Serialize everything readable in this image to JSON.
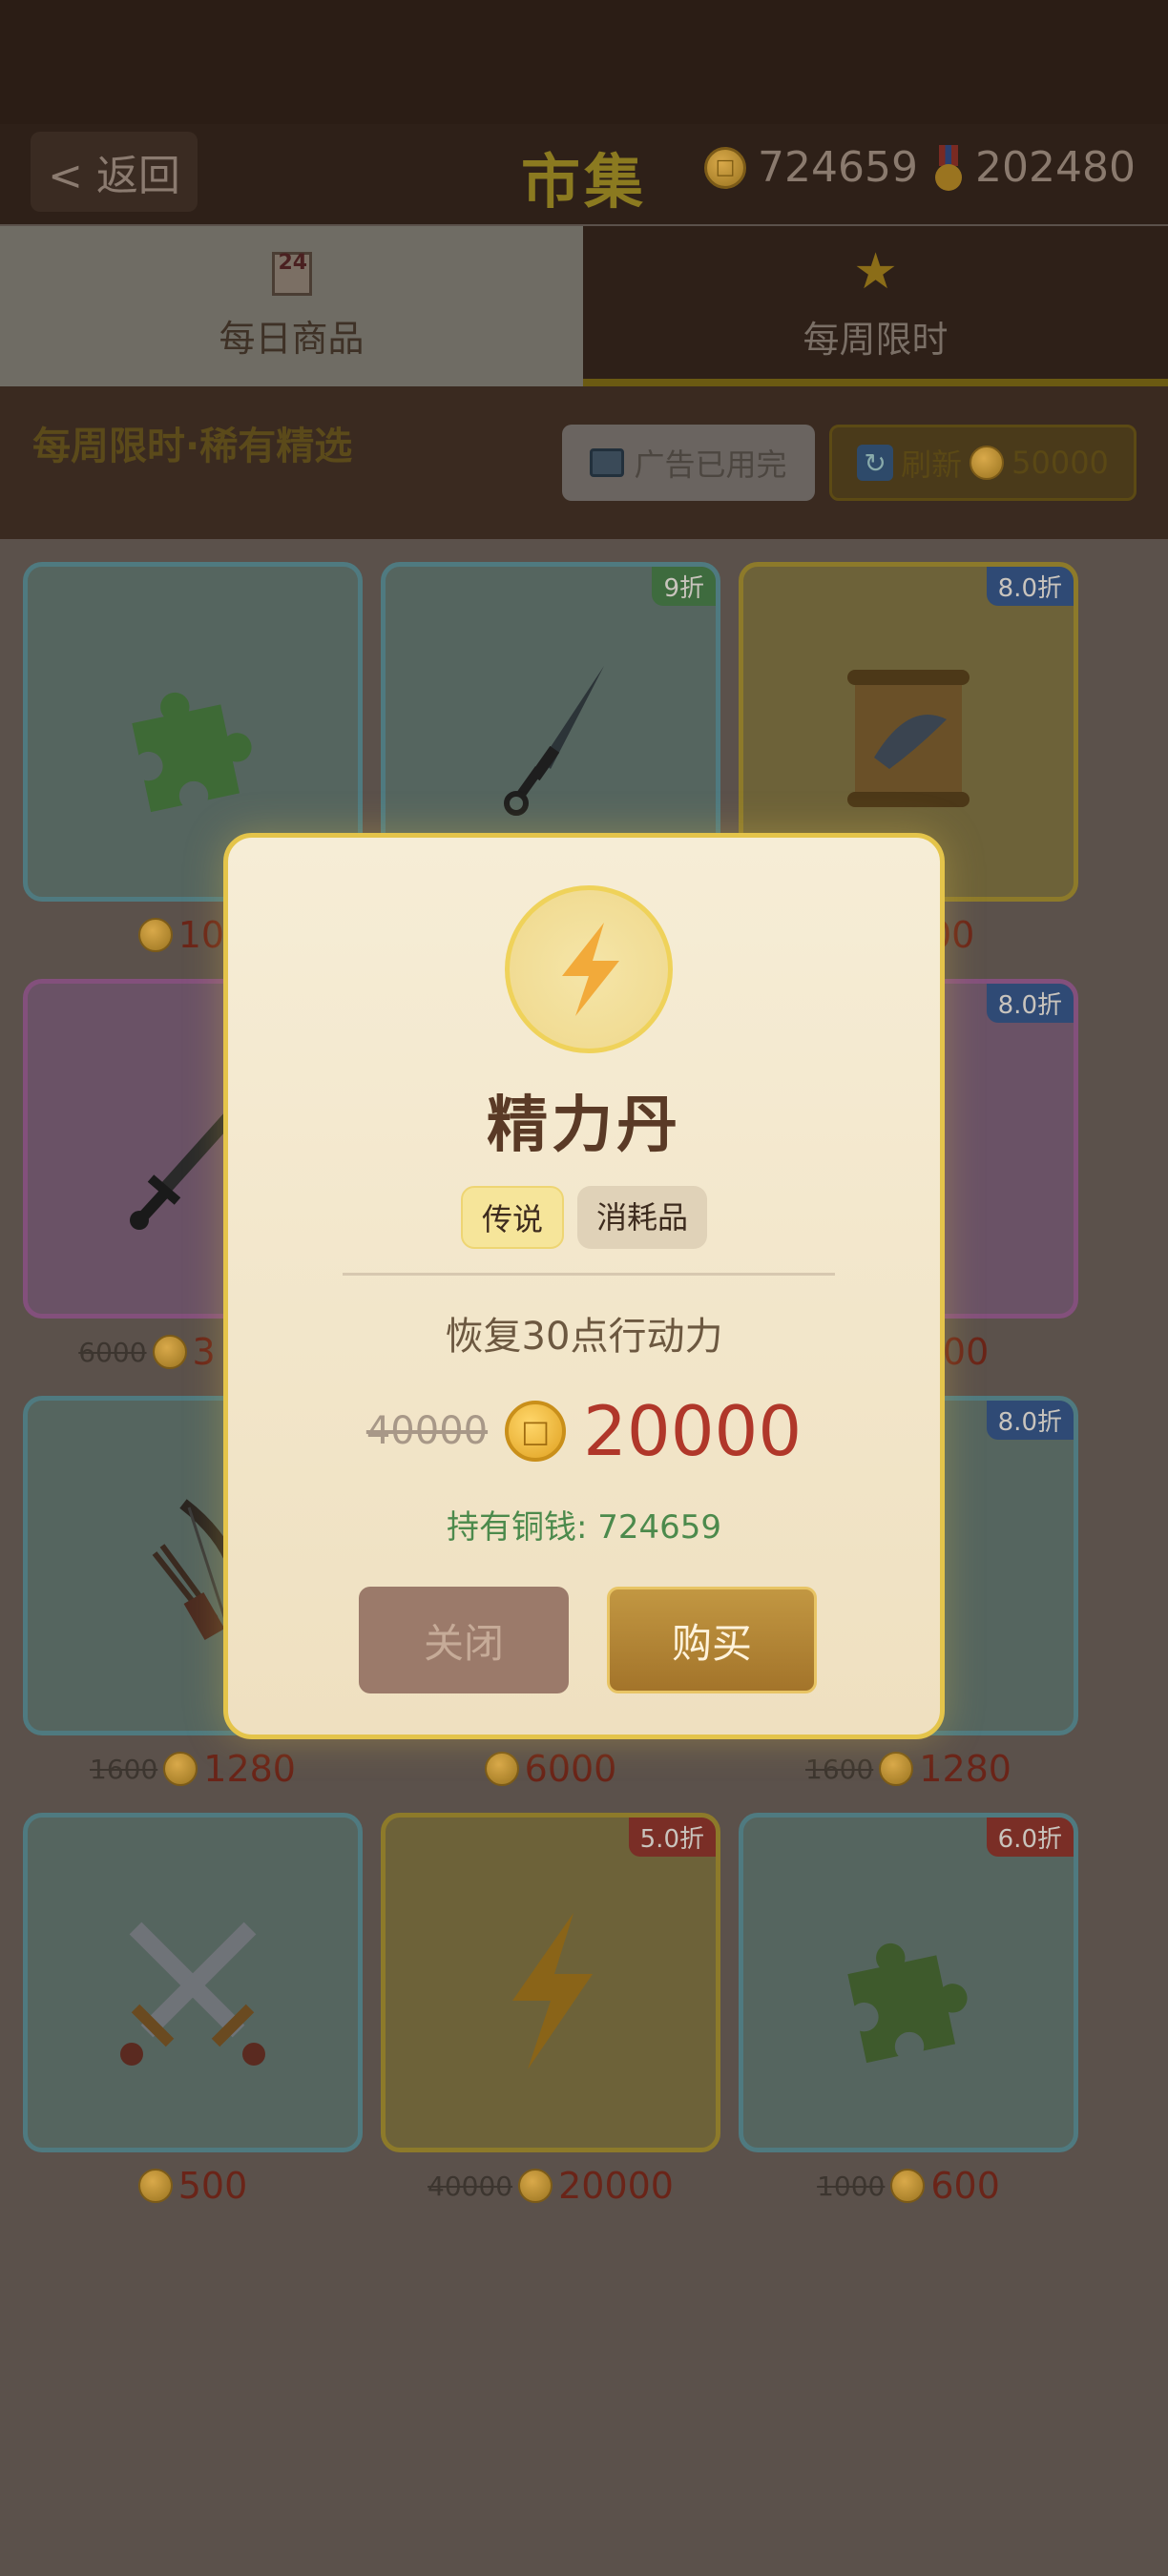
{
  "header": {
    "back_label": "< 返回",
    "title": "市集",
    "coins": "724659",
    "medals": "202480"
  },
  "tabs": [
    {
      "label": "每日商品",
      "icon": "calendar-24-icon",
      "active": false
    },
    {
      "label": "每周限时",
      "icon": "star-icon",
      "active": true
    }
  ],
  "subheader": {
    "title": "每周限时·稀有精选",
    "ad_label": "广告已用完",
    "refresh_label": "刷新",
    "refresh_cost": "50000"
  },
  "grid": {
    "cards": [
      {
        "icon": "puzzle-icon",
        "color": "blue",
        "badge": "",
        "old_price": "",
        "price": "100"
      },
      {
        "icon": "dagger-icon",
        "color": "blue",
        "badge": "9折",
        "old_price": "",
        "price": ""
      },
      {
        "icon": "scroll-icon",
        "color": "gold",
        "badge": "8.0折",
        "old_price": "",
        "price": "6000"
      },
      {
        "icon": "sword-icon",
        "color": "purple",
        "badge": "",
        "old_price": "6000",
        "price": "3"
      },
      {
        "icon": "",
        "color": "blue",
        "badge": "",
        "old_price": "",
        "price": ""
      },
      {
        "icon": "helmet-icon",
        "color": "purple",
        "badge": "8.0折",
        "old_price": "",
        "price": "800"
      },
      {
        "icon": "bow-icon",
        "color": "blue",
        "badge": "",
        "old_price": "1600",
        "price": "1280"
      },
      {
        "icon": "",
        "color": "blue",
        "badge": "",
        "old_price": "",
        "price": "6000"
      },
      {
        "icon": "arrow-icon",
        "color": "blue",
        "badge": "8.0折",
        "old_price": "1600",
        "price": "1280"
      },
      {
        "icon": "crossed-swords-icon",
        "color": "blue",
        "badge": "",
        "old_price": "",
        "price": "500"
      },
      {
        "icon": "lightning-icon",
        "color": "gold",
        "badge": "5.0折",
        "old_price": "40000",
        "price": "20000"
      },
      {
        "icon": "puzzle-icon",
        "color": "blue",
        "badge": "6.0折",
        "old_price": "1000",
        "price": "600"
      }
    ]
  },
  "modal": {
    "icon": "lightning-icon",
    "item_name": "精力丹",
    "tag_rarity": "传说",
    "tag_type": "消耗品",
    "description": "恢复30点行动力",
    "old_price": "40000",
    "price": "20000",
    "held_label": "持有铜钱: 724659",
    "close_label": "关闭",
    "buy_label": "购买"
  },
  "colors": {
    "accent_gold": "#e4c44a",
    "price_red": "#b0372a",
    "held_green": "#4c8a4c"
  }
}
